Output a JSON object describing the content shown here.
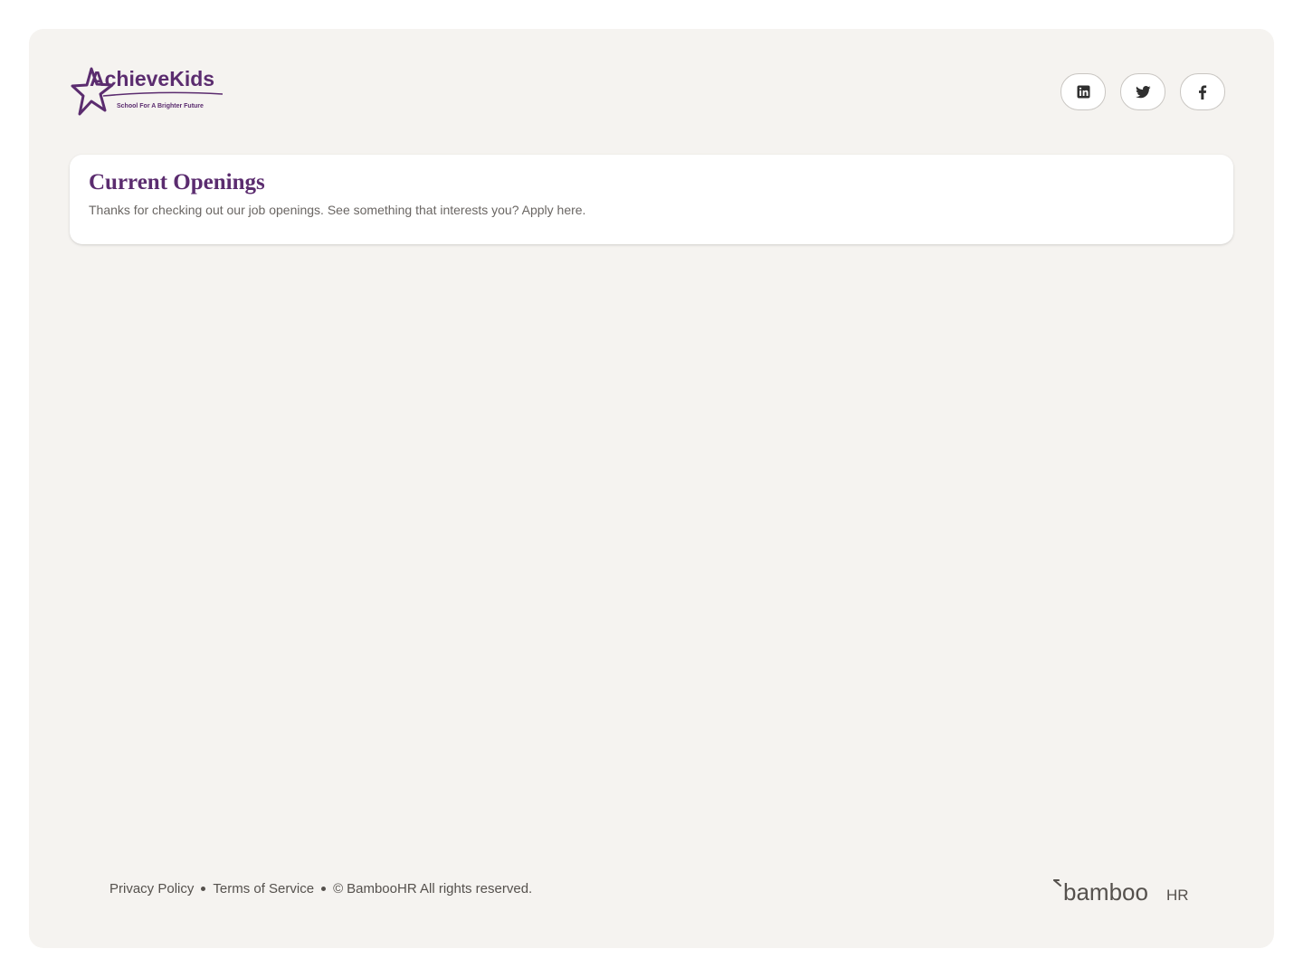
{
  "header": {
    "logo": {
      "name": "AchieveKids",
      "tagline": "School For A Brighter Future",
      "color": "#5b2c6f"
    },
    "social_links": [
      {
        "name": "linkedin-icon"
      },
      {
        "name": "twitter-icon"
      },
      {
        "name": "facebook-icon"
      }
    ]
  },
  "openings": {
    "title": "Current Openings",
    "subtitle": "Thanks for checking out our job openings. See something that interests you? Apply here."
  },
  "footer": {
    "privacy_label": "Privacy Policy",
    "terms_label": "Terms of Service",
    "copyright_symbol": "©",
    "copyright_text": "BambooHR All rights reserved.",
    "brand": {
      "main": "bamboo",
      "suffix": "HR"
    }
  },
  "colors": {
    "accent": "#5b2c6f",
    "page_bg": "#f5f3f0",
    "card_bg": "#ffffff",
    "footer_text": "#55514d"
  }
}
